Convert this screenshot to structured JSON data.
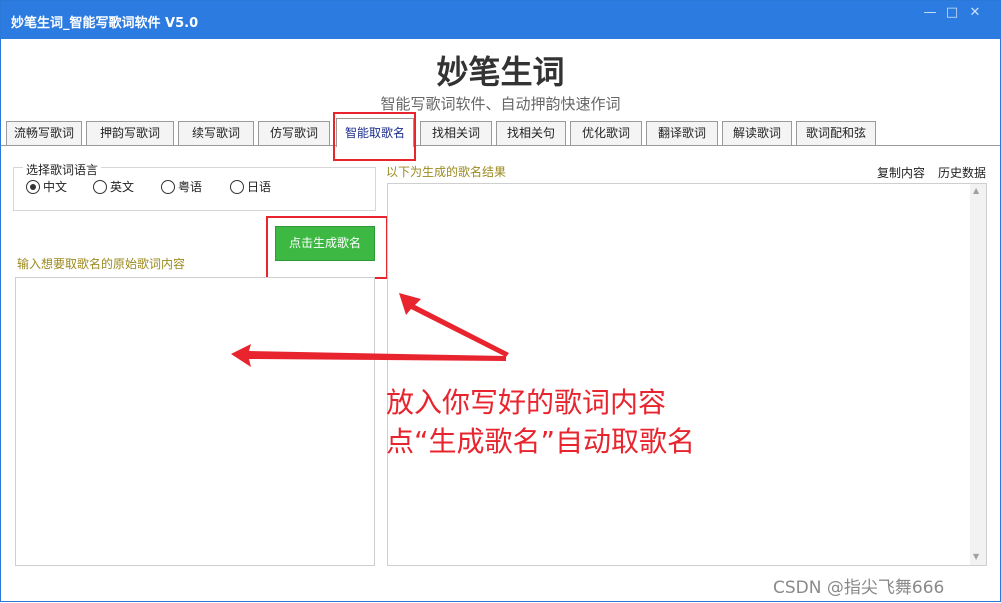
{
  "window": {
    "title": "妙笔生词_智能写歌词软件 V5.0",
    "minimize_glyph": "—",
    "maximize_glyph": "□",
    "close_glyph": "✕"
  },
  "header": {
    "app_name": "妙笔生词",
    "subtitle": "智能写歌词软件、自动押韵快速作词"
  },
  "tabs": [
    {
      "label": "流畅写歌词"
    },
    {
      "label": "押韵写歌词"
    },
    {
      "label": "续写歌词"
    },
    {
      "label": "仿写歌词"
    },
    {
      "label": "智能取歌名",
      "active": true
    },
    {
      "label": "找相关词"
    },
    {
      "label": "找相关句"
    },
    {
      "label": "优化歌词"
    },
    {
      "label": "翻译歌词"
    },
    {
      "label": "解读歌词"
    },
    {
      "label": "歌词配和弦"
    }
  ],
  "language": {
    "legend": "选择歌词语言",
    "options": [
      {
        "label": "中文",
        "selected": true
      },
      {
        "label": "英文",
        "selected": false
      },
      {
        "label": "粤语",
        "selected": false
      },
      {
        "label": "日语",
        "selected": false
      }
    ]
  },
  "generate_button": "点击生成歌名",
  "input_panel": {
    "label": "输入想要取歌名的原始歌词内容",
    "value": ""
  },
  "result_panel": {
    "label": "以下为生成的歌名结果",
    "copy": "复制内容",
    "history": "历史数据",
    "value": ""
  },
  "annotation": {
    "line1": "放入你写好的歌词内容",
    "line2": "点“生成歌名”自动取歌名"
  },
  "watermark": "CSDN @指尖飞舞666",
  "colors": {
    "titlebar": "#2b7be0",
    "primary_button": "#3db843",
    "highlight": "#e8252e",
    "section_label": "#9b8a1f"
  }
}
